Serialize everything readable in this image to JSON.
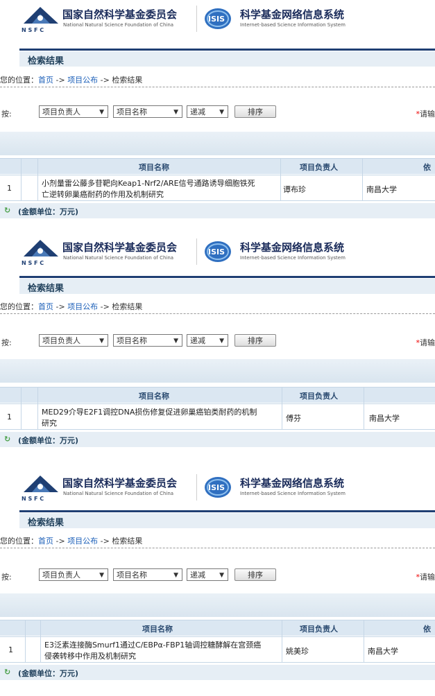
{
  "header": {
    "nsfc_title": "国家自然科学基金委员会",
    "nsfc_subtitle": "National Natural Science Foundation of China",
    "nsfc_abbr": "N S F C",
    "isis_logo_text": "ISIS",
    "isis_title": "科学基金网络信息系统",
    "isis_subtitle": "Internet-based Science Information System"
  },
  "page": {
    "section_title": "检索结果",
    "breadcrumb_prefix": "您的位置：",
    "breadcrumb_home": "首页",
    "breadcrumb_sep1": " -> ",
    "breadcrumb_projects": "项目公布",
    "breadcrumb_sep2": " -> ",
    "breadcrumb_current": "检索结果",
    "sort_label": "按:",
    "select_leader": "项目负责人",
    "select_name": "项目名称",
    "select_order": "递减",
    "sort_button": "排序",
    "hint_star": "*",
    "hint_text": "请输",
    "col_name": "项目名称",
    "col_leader": "项目负责人",
    "col_next": "依",
    "footer_unit": "(金额单位：万元)"
  },
  "results": [
    {
      "index": "1",
      "name_line1": "小剂量雷公藤多苷靶向Keap1-Nrf2/ARE信号通路诱导细胞铁死",
      "name_line2": "亡逆转卵巢癌耐药的作用及机制研究",
      "leader": "谭布珍",
      "unit": "南昌大学"
    },
    {
      "index": "1",
      "name_line1": "MED29介导E2F1调控DNA损伤修复促进卵巢癌铂类耐药的机制",
      "name_line2": "研究",
      "leader": "傅芬",
      "unit": "南昌大学"
    },
    {
      "index": "1",
      "name_line1": "E3泛素连接酶Smurf1通过C/EBPα-FBP1轴调控糖酵解在宫颈癌",
      "name_line2": "侵袭转移中作用及机制研究",
      "leader": "姚美珍",
      "unit": "南昌大学"
    }
  ]
}
